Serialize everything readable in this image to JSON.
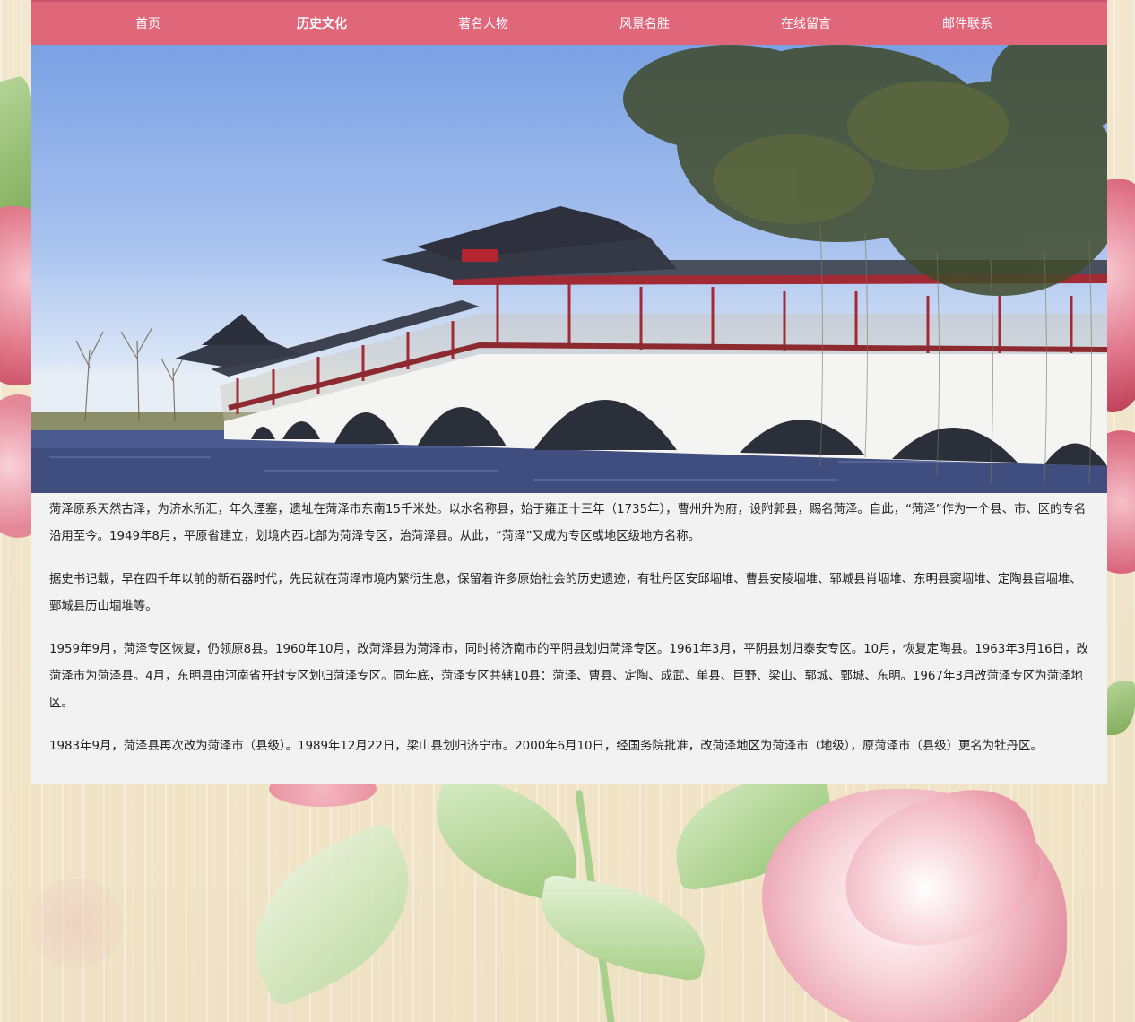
{
  "nav": {
    "items": [
      {
        "label": "首页"
      },
      {
        "label": "历史文化",
        "active": true
      },
      {
        "label": "著名人物"
      },
      {
        "label": "风景名胜"
      },
      {
        "label": "在线留言"
      },
      {
        "label": "邮件联系"
      }
    ]
  },
  "content": {
    "paragraphs": [
      "菏泽原系天然古泽，为济水所汇，年久湮塞，遗址在菏泽市东南15千米处。以水名称县，始于雍正十三年（1735年），曹州升为府，设附郭县，赐名菏泽。自此，“菏泽”作为一个县、市、区的专名沿用至今。1949年8月，平原省建立，划境内西北部为菏泽专区，治菏泽县。从此，“菏泽”又成为专区或地区级地方名称。",
      "据史书记载，早在四千年以前的新石器时代，先民就在菏泽市境内繁衍生息，保留着许多原始社会的历史遗迹，有牡丹区安邱堌堆、曹县安陵堌堆、郓城县肖堌堆、东明县窦堌堆、定陶县官堌堆、鄄城县历山堌堆等。",
      "1959年9月，菏泽专区恢复，仍领原8县。1960年10月，改菏泽县为菏泽市，同时将济南市的平阴县划归菏泽专区。1961年3月，平阴县划归泰安专区。10月，恢复定陶县。1963年3月16日，改菏泽市为菏泽县。4月，东明县由河南省开封专区划归菏泽专区。同年底，菏泽专区共辖10县：菏泽、曹县、定陶、成武、单县、巨野、梁山、郓城、鄄城、东明。1967年3月改菏泽专区为菏泽地区。",
      "1983年9月，菏泽县再次改为菏泽市（县级）。1989年12月22日，梁山县划归济宁市。2000年6月10日，经国务院批准，改菏泽地区为菏泽市（地级），原菏泽市（县级）更名为牡丹区。"
    ]
  },
  "colors": {
    "nav_bg": "#e0677a",
    "content_bg": "#f2f2f2",
    "page_bg": "#f1e6cc"
  }
}
